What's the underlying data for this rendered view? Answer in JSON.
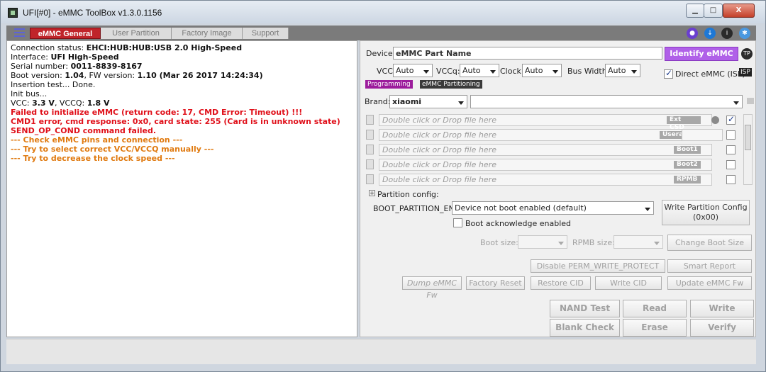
{
  "window": {
    "title": "UFI[#0] - eMMC ToolBox v1.3.0.1156",
    "min": "▁",
    "max": "□",
    "close": "X"
  },
  "tabs": [
    "eMMC General",
    "User Partition",
    "Factory Image",
    "Support"
  ],
  "icons": {
    "menu": "hamburger-icon",
    "globe": "globe-icon",
    "download": "download-icon",
    "info": "info-icon",
    "gear": "gear-icon"
  },
  "log": [
    {
      "t": "Connection status: ",
      "b": "EHCI:HUB:HUB:USB 2.0 High-Speed",
      "c": "n"
    },
    {
      "t": "Interface: ",
      "b": "UFI High-Speed",
      "c": "n"
    },
    {
      "t": "Serial number: ",
      "b": "0011-8839-8167",
      "c": "n"
    },
    {
      "t": " Boot version: ",
      "b": "1.04",
      "t2": ", FW version: ",
      "b2": "1.10 (Mar 26 2017 14:24:34)",
      "c": "n"
    },
    {
      "t": "Insertion test... Done.",
      "c": "n"
    },
    {
      "t": "Init bus...",
      "c": "n"
    },
    {
      "t": "VCC: ",
      "b": "3.3 V",
      "t2": ", VCCQ: ",
      "b2": "1.8 V",
      "c": "n"
    },
    {
      "t": "Failed to initialize eMMC (return code: 17, CMD Error: Timeout) !!!",
      "c": "r"
    },
    {
      "t": " CMD1 error, cmd response: 0x0, card state: 255 (Card is in unknown state)",
      "c": "r"
    },
    {
      "t": " SEND_OP_COND command failed.",
      "c": "r"
    },
    {
      "t": "--- Check eMMC pins and connection ---",
      "c": "o"
    },
    {
      "t": "--- Try to select correct VCC/VCCQ manually ---",
      "c": "o"
    },
    {
      "t": "--- Try to decrease the clock speed ---",
      "c": "o"
    }
  ],
  "device": {
    "label": "Device:",
    "value": "eMMC Part Name",
    "identify": "Identify eMMC",
    "tp": "TP"
  },
  "vcc": {
    "label": "VCC:",
    "value": "Auto"
  },
  "vccq": {
    "label": "VCCq:",
    "value": "Auto"
  },
  "clock": {
    "label": "Clock:",
    "value": "Auto"
  },
  "bus": {
    "label": "Bus Width:",
    "value": "Auto"
  },
  "direct": {
    "label": "Direct eMMC (ISP)",
    "isp": "ISP"
  },
  "subtabs": [
    "Programming",
    "eMMC Partitioning"
  ],
  "brand": {
    "label": "Brand:",
    "value": "xiaomi"
  },
  "files": [
    {
      "placeholder": "Double click or Drop file here",
      "badge": "Ext CSD",
      "checked": true
    },
    {
      "placeholder": "Double click or Drop file here",
      "badge": "Userarea",
      "checked": false
    },
    {
      "placeholder": "Double click or Drop file here",
      "badge": "Boot1",
      "checked": false
    },
    {
      "placeholder": "Double click or Drop file here",
      "badge": "Boot2",
      "checked": false
    },
    {
      "placeholder": "Double click or Drop file here",
      "badge": "RPMB",
      "checked": false
    }
  ],
  "partition": {
    "toggle": "+",
    "label": "Partition config:",
    "boot_label": "BOOT_PARTITION_EN",
    "boot_value": "Device not boot enabled (default)",
    "write_btn_1": "Write Partition Config",
    "write_btn_2": "(0x00)",
    "ack_label": "Boot acknowledge enabled"
  },
  "sizes": {
    "boot_label": "Boot size:",
    "rpmb_label": "RPMB size:",
    "change_btn": "Change Boot Size"
  },
  "buttons": {
    "disable_perm": "Disable PERM_WRITE_PROTECT",
    "smart": "Smart Report",
    "dump_fw": "Dump eMMC Fw",
    "factory_reset": "Factory Reset",
    "restore_cid": "Restore CID",
    "write_cid": "Write CID",
    "update_fw": "Update eMMC Fw",
    "nand_test": "NAND Test",
    "read": "Read",
    "write": "Write",
    "blank_check": "Blank Check",
    "erase": "Erase",
    "verify": "Verify"
  },
  "colors": {
    "accent": "#c0242a",
    "identify": "#b060e8",
    "log_error": "#e0101a",
    "log_warn": "#e07a10"
  }
}
